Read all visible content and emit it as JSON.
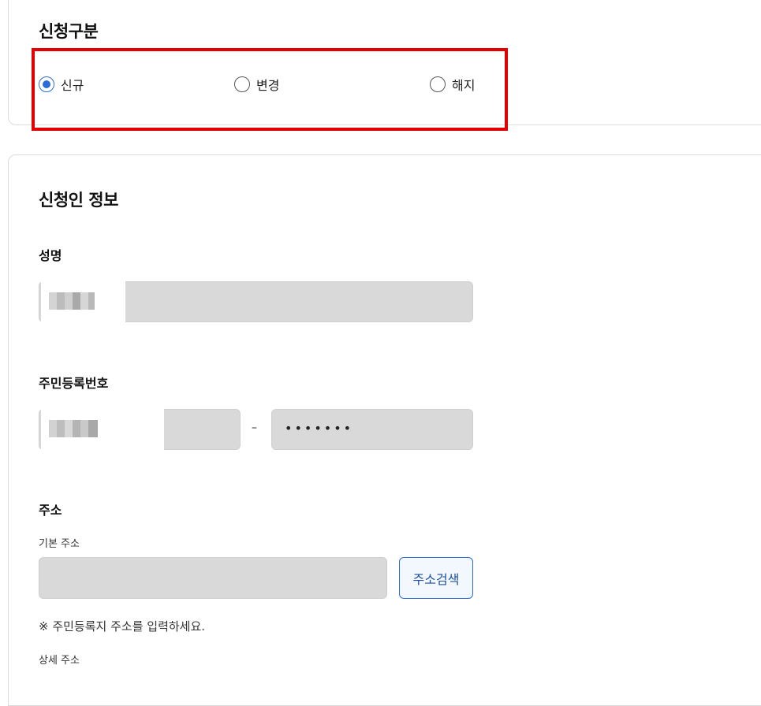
{
  "application_type": {
    "title": "신청구분",
    "options": [
      {
        "label": "신규",
        "checked": true
      },
      {
        "label": "변경",
        "checked": false
      },
      {
        "label": "해지",
        "checked": false
      }
    ]
  },
  "applicant": {
    "title": "신청인 정보",
    "name_label": "성명",
    "rrn_label": "주민등록번호",
    "rrn_separator": "–",
    "rrn_back_masked": "•••••••",
    "address_label": "주소",
    "basic_address_label": "기본 주소",
    "search_button": "주소검색",
    "address_notice": "※ 주민등록지 주소를 입력하세요.",
    "detail_address_label": "상세 주소"
  },
  "colors": {
    "accent": "#2b6bd6",
    "highlight": "#e30000",
    "input_bg": "#d9d9d9"
  }
}
